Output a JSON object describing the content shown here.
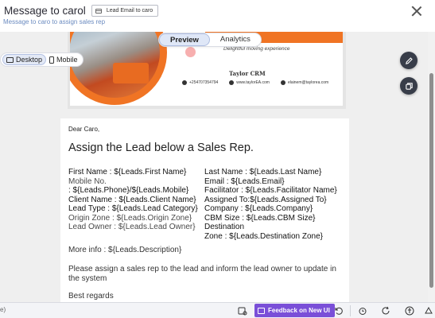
{
  "header": {
    "title": "Message to carol",
    "tag_label": "Lead Email to caro",
    "subtitle": "Message to caro to assign sales rep"
  },
  "view_tabs": [
    "Preview",
    "Analytics"
  ],
  "device_tabs": [
    "Desktop",
    "Mobile"
  ],
  "banner": {
    "tagline": "Delightful moving experience",
    "brand": "Taylor CRM",
    "phone": "+254707354794",
    "website": "www.taylorEA.com",
    "email": "elainem@taylorea.com"
  },
  "email": {
    "greeting": "Dear Caro,",
    "heading": "Assign the Lead below a Sales Rep.",
    "left_fields": [
      "First Name : ${Leads.First Name}",
      "Mobile No.",
      ": ${Leads.Phone}/${Leads.Mobile}",
      "Client Name : ${Leads.Client Name}",
      "Lead Type : ${Leads.Lead Category}",
      "Origin Zone : ${Leads.Origin Zone}",
      "Lead Owner : ${Leads.Lead Owner}"
    ],
    "right_fields": [
      "Last Name : ${Leads.Last Name}",
      "Email : ${Leads.Email}",
      "Facilitator : ${Leads.Facilitator Name}",
      "Assigned To:${Leads.Assigned To}",
      "Company : ${Leads.Company}",
      "CBM Size : ${Leads.CBM Size}",
      "Destination",
      "Zone : ${Leads.Destination Zone}"
    ],
    "more_info": "More info : ${Leads.Description}",
    "instruction": "Please assign a sales rep to the lead and inform the lead owner to update in the system",
    "closing": "Best regards"
  },
  "toolbar": {
    "left_text": "e)",
    "feedback_label": "Feedback on New UI"
  },
  "icons": {
    "edit": "pencil-icon",
    "duplicate": "copy-icon",
    "close": "close-icon"
  },
  "colors": {
    "accent": "#7a4fd8",
    "brand_orange": "#f07424",
    "fab": "#383d49"
  }
}
